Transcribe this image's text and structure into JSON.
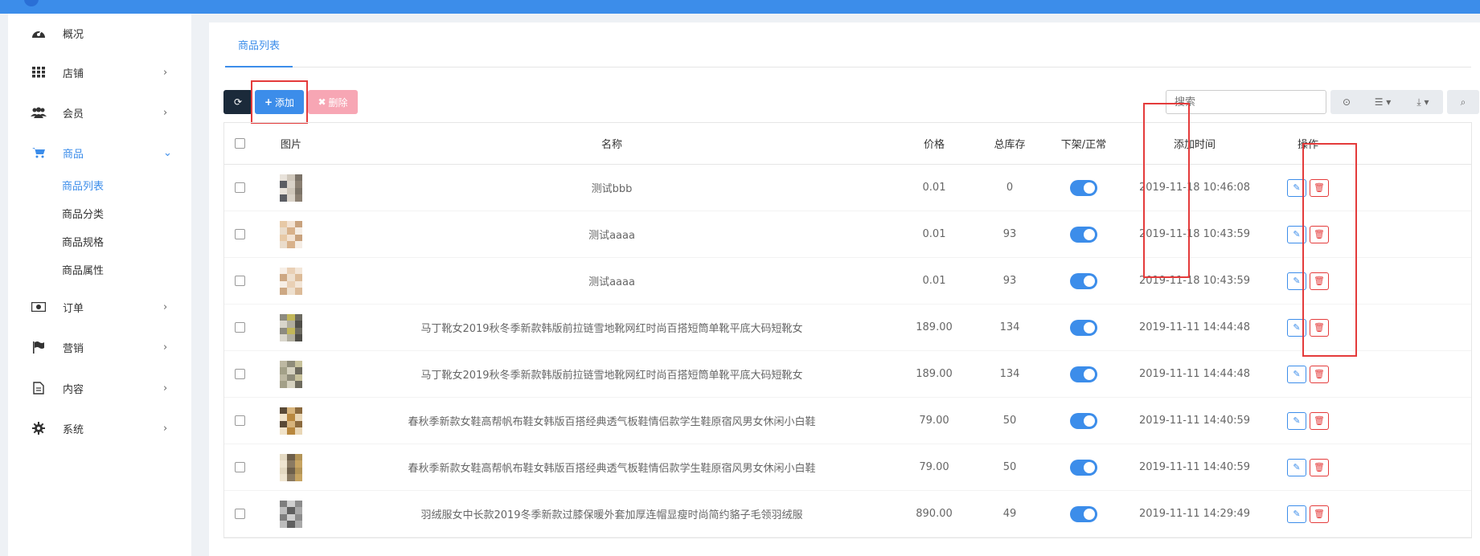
{
  "sidebar": {
    "items": [
      {
        "label": "概况",
        "icon": "dashboard-icon"
      },
      {
        "label": "店铺",
        "icon": "grid-icon"
      },
      {
        "label": "会员",
        "icon": "users-icon"
      },
      {
        "label": "商品",
        "icon": "cart-icon"
      },
      {
        "label": "订单",
        "icon": "money-icon"
      },
      {
        "label": "营销",
        "icon": "flag-icon"
      },
      {
        "label": "内容",
        "icon": "document-icon"
      },
      {
        "label": "系统",
        "icon": "gear-icon"
      }
    ],
    "sub_items": [
      "商品列表",
      "商品分类",
      "商品规格",
      "商品属性"
    ]
  },
  "main": {
    "tab": "商品列表",
    "toolbar": {
      "add_label": "添加",
      "delete_label": "删除",
      "search_placeholder": "搜索"
    },
    "table": {
      "headers": [
        "图片",
        "名称",
        "价格",
        "总库存",
        "下架/正常",
        "添加时间",
        "操作"
      ],
      "rows": [
        {
          "name": "测试bbb",
          "price": "0.01",
          "stock": "0",
          "time": "2019-11-18 10:46:08"
        },
        {
          "name": "测试aaaa",
          "price": "0.01",
          "stock": "93",
          "time": "2019-11-18 10:43:59"
        },
        {
          "name": "测试aaaa",
          "price": "0.01",
          "stock": "93",
          "time": "2019-11-18 10:43:59"
        },
        {
          "name": "马丁靴女2019秋冬季新款韩版前拉链雪地靴网红时尚百搭短筒单靴平底大码短靴女",
          "price": "189.00",
          "stock": "134",
          "time": "2019-11-11 14:44:48"
        },
        {
          "name": "马丁靴女2019秋冬季新款韩版前拉链雪地靴网红时尚百搭短筒单靴平底大码短靴女",
          "price": "189.00",
          "stock": "134",
          "time": "2019-11-11 14:44:48"
        },
        {
          "name": "春秋季新款女鞋高帮帆布鞋女韩版百搭经典透气板鞋情侣款学生鞋原宿风男女休闲小白鞋",
          "price": "79.00",
          "stock": "50",
          "time": "2019-11-11 14:40:59"
        },
        {
          "name": "春秋季新款女鞋高帮帆布鞋女韩版百搭经典透气板鞋情侣款学生鞋原宿风男女休闲小白鞋",
          "price": "79.00",
          "stock": "50",
          "time": "2019-11-11 14:40:59"
        },
        {
          "name": "羽绒服女中长款2019冬季新款过膝保暖外套加厚连帽显瘦时尚简约貉子毛领羽绒服",
          "price": "890.00",
          "stock": "49",
          "time": "2019-11-11 14:29:49"
        }
      ]
    }
  },
  "colors": {
    "accent": "#3c8dea",
    "danger": "#e43b3b",
    "highlight": "#e43b3b"
  }
}
